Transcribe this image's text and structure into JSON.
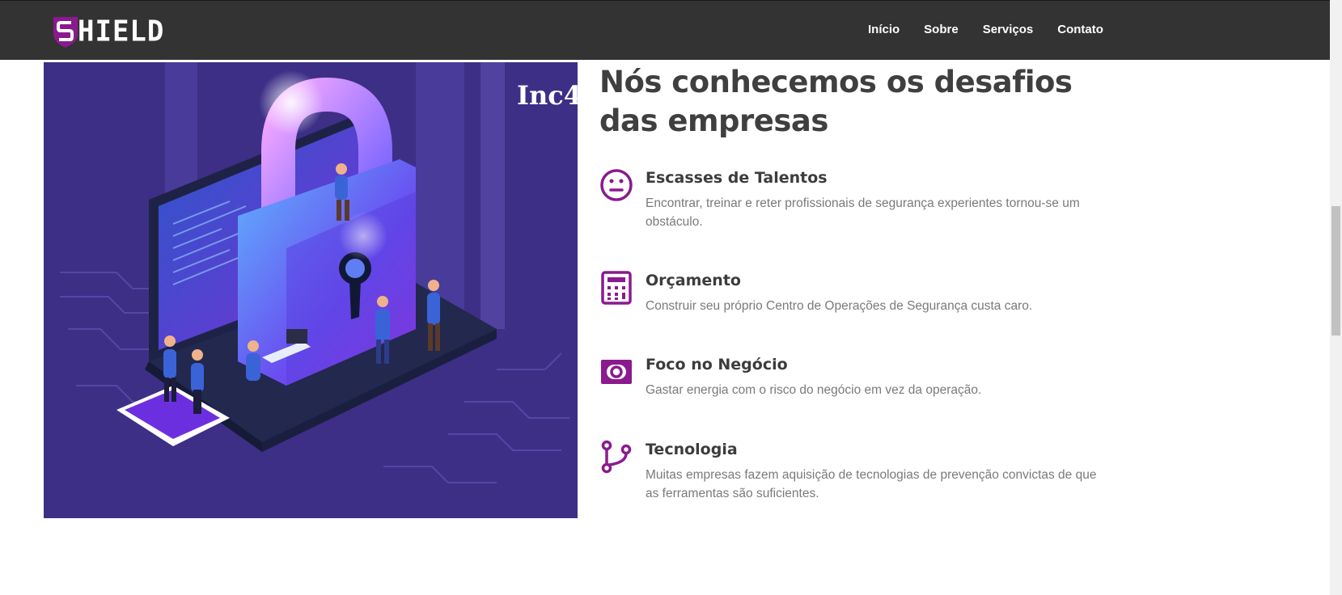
{
  "brand": {
    "logo_text": "HIELD",
    "logo_color": "#8a1a8e"
  },
  "nav": {
    "items": [
      {
        "label": "Início"
      },
      {
        "label": "Sobre"
      },
      {
        "label": "Serviços"
      },
      {
        "label": "Contato"
      }
    ]
  },
  "illustration": {
    "watermark": "Inc4"
  },
  "section": {
    "title_line1": "Nós conhecemos os desafios",
    "title_line2": "das empresas"
  },
  "features": [
    {
      "icon": "neutral-face-icon",
      "title": "Escasses de Talentos",
      "description": "Encontrar, treinar e reter profissionais de segurança experientes tornou-se um obstáculo."
    },
    {
      "icon": "calculator-icon",
      "title": "Orçamento",
      "description": "Construir seu próprio Centro de Operações de Segurança custa caro."
    },
    {
      "icon": "money-bill-icon",
      "title": "Foco no Negócio",
      "description": "Gastar energia com o risco do negócio em vez da operação."
    },
    {
      "icon": "git-branch-icon",
      "title": "Tecnologia",
      "description": "Muitas empresas fazem aquisição de tecnologias de prevenção convictas de que as ferramentas são suficientes."
    }
  ],
  "colors": {
    "navbar_bg": "#333333",
    "accent_purple": "#8a1a8e",
    "illustration_bg": "#3d2f86",
    "heading_text": "#3f3f3f",
    "body_text": "#7a7a7a"
  }
}
